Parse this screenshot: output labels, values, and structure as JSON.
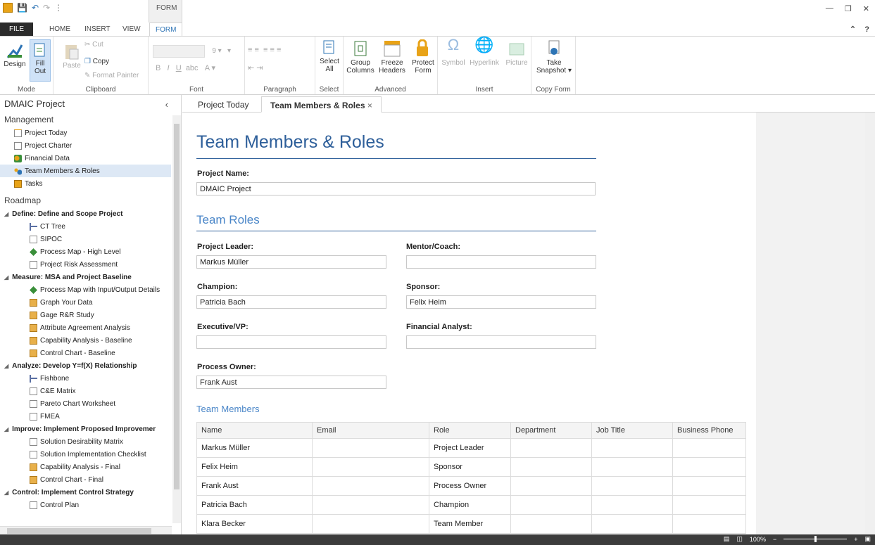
{
  "titlebar": {
    "context_tab": "FORM"
  },
  "menu_tabs": {
    "file": "FILE",
    "home": "HOME",
    "insert": "INSERT",
    "view": "VIEW",
    "form": "FORM"
  },
  "ribbon": {
    "mode": {
      "label": "Mode",
      "design": "Design",
      "fill_out": "Fill Out"
    },
    "clipboard": {
      "label": "Clipboard",
      "paste": "Paste",
      "cut": "Cut",
      "copy": "Copy",
      "format_painter": "Format Painter"
    },
    "font": {
      "label": "Font",
      "size": "9"
    },
    "paragraph": {
      "label": "Paragraph"
    },
    "select": {
      "label": "Select",
      "select_all": "Select All"
    },
    "advanced": {
      "label": "Advanced",
      "group_columns": "Group Columns",
      "freeze_headers": "Freeze Headers",
      "protect_form": "Protect Form"
    },
    "insert": {
      "label": "Insert",
      "symbol": "Symbol",
      "hyperlink": "Hyperlink",
      "picture": "Picture"
    },
    "copy_form": {
      "label": "Copy Form",
      "take_snapshot": "Take Snapshot"
    }
  },
  "sidebar": {
    "title": "DMAIC Project",
    "management_label": "Management",
    "management": [
      "Project Today",
      "Project Charter",
      "Financial Data",
      "Team Members & Roles",
      "Tasks"
    ],
    "roadmap_label": "Roadmap",
    "phases": [
      {
        "name": "Define: Define and Scope Project",
        "items": [
          "CT Tree",
          "SIPOC",
          "Process Map - High Level",
          "Project Risk Assessment"
        ]
      },
      {
        "name": "Measure: MSA and Project Baseline",
        "items": [
          "Process Map with Input/Output Details",
          "Graph Your Data",
          "Gage R&R Study",
          "Attribute Agreement Analysis",
          "Capability Analysis - Baseline",
          "Control Chart - Baseline"
        ]
      },
      {
        "name": "Analyze: Develop Y=f(X) Relationship",
        "items": [
          "Fishbone",
          "C&E Matrix",
          "Pareto Chart Worksheet",
          "FMEA"
        ]
      },
      {
        "name": "Improve: Implement Proposed Improvemer",
        "items": [
          "Solution Desirability Matrix",
          "Solution Implementation Checklist",
          "Capability Analysis - Final",
          "Control Chart - Final"
        ]
      },
      {
        "name": "Control: Implement Control Strategy",
        "items": [
          "Control Plan"
        ]
      }
    ]
  },
  "doc_tabs": {
    "tab1": "Project Today",
    "tab2": "Team Members & Roles"
  },
  "form": {
    "title": "Team Members & Roles",
    "project_name_label": "Project Name:",
    "project_name": "DMAIC Project",
    "team_roles_heading": "Team Roles",
    "project_leader_label": "Project Leader:",
    "project_leader": "Markus Müller",
    "mentor_label": "Mentor/Coach:",
    "mentor": "",
    "champion_label": "Champion:",
    "champion": "Patricia Bach",
    "sponsor_label": "Sponsor:",
    "sponsor": "Felix Heim",
    "executive_label": "Executive/VP:",
    "executive": "",
    "financial_label": "Financial Analyst:",
    "financial": "",
    "process_owner_label": "Process Owner:",
    "process_owner": "Frank Aust",
    "team_members_heading": "Team Members",
    "columns": [
      "Name",
      "Email",
      "Role",
      "Department",
      "Job Title",
      "Business Phone"
    ],
    "rows": [
      [
        "Markus Müller",
        "",
        "Project Leader",
        "",
        "",
        ""
      ],
      [
        "Felix Heim",
        "",
        "Sponsor",
        "",
        "",
        ""
      ],
      [
        "Frank Aust",
        "",
        "Process Owner",
        "",
        "",
        ""
      ],
      [
        "Patricia Bach",
        "",
        "Champion",
        "",
        "",
        ""
      ],
      [
        "Klara Becker",
        "",
        "Team Member",
        "",
        "",
        ""
      ]
    ]
  },
  "status": {
    "zoom": "100%"
  },
  "colors": {
    "accent": "#2e74b5",
    "heading": "#2e5f9a"
  }
}
